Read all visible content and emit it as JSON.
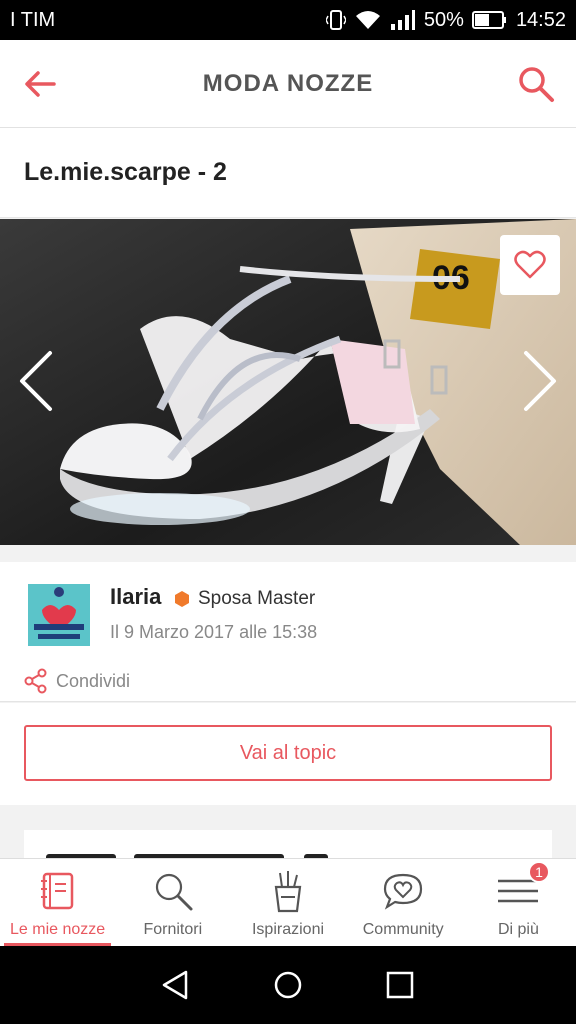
{
  "status_bar": {
    "carrier": "I TIM",
    "battery": "50%",
    "time": "14:52"
  },
  "app_bar": {
    "title": "MODA NOZZE"
  },
  "album": {
    "title": "Le.mie.scarpe - 2"
  },
  "author": {
    "name": "Ilaria",
    "badge": "Sposa Master",
    "date": "Il 9 Marzo 2017 alle 15:38",
    "share_label": "Condividi"
  },
  "actions": {
    "topic_button": "Vai al topic"
  },
  "bottom_nav": {
    "items": [
      {
        "label": "Le mie nozze",
        "icon": "notebook-icon",
        "active": true
      },
      {
        "label": "Fornitori",
        "icon": "search-icon",
        "active": false
      },
      {
        "label": "Ispirazioni",
        "icon": "pencil-cup-icon",
        "active": false
      },
      {
        "label": "Community",
        "icon": "heart-chat-icon",
        "active": false
      },
      {
        "label": "Di più",
        "icon": "menu-icon",
        "active": false,
        "badge": "1"
      }
    ]
  },
  "colors": {
    "accent": "#e8585f",
    "text": "#222222",
    "muted": "#888888",
    "badge_orange": "#f07a2b"
  }
}
